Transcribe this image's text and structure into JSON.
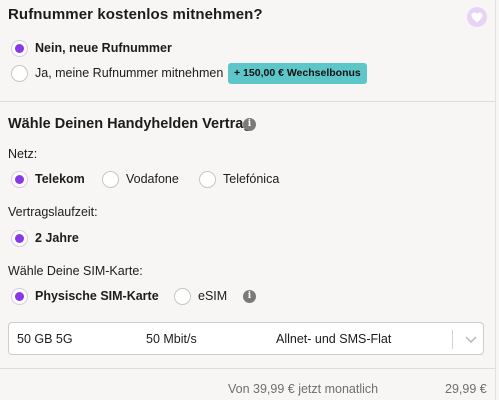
{
  "number_section": {
    "title": "Rufnummer kostenlos mitnehmen?",
    "options": [
      {
        "label": "Nein, neue Rufnummer",
        "checked": true
      },
      {
        "label": "Ja, meine Rufnummer mitnehmen",
        "checked": false
      }
    ],
    "bonus_badge": "+ 150,00 € Wechselbonus"
  },
  "contract_section": {
    "title": "Wähle Deinen Handyhelden Vertrag",
    "network": {
      "label": "Netz:",
      "options": [
        {
          "label": "Telekom",
          "checked": true
        },
        {
          "label": "Vodafone",
          "checked": false
        },
        {
          "label": "Telefónica",
          "checked": false
        }
      ]
    },
    "term": {
      "label": "Vertragslaufzeit:",
      "options": [
        {
          "label": "2 Jahre",
          "checked": true
        }
      ]
    },
    "sim": {
      "label": "Wähle Deine SIM-Karte:",
      "options": [
        {
          "label": "Physische SIM-Karte",
          "checked": true
        },
        {
          "label": "eSIM",
          "checked": false
        }
      ]
    },
    "tariff_select": {
      "data": "50 GB 5G",
      "speed": "50 Mbit/s",
      "flat": "Allnet- und SMS-Flat"
    }
  },
  "footer": {
    "old_price_text": "Von 39,99 € jetzt monatlich",
    "new_price": "29,99 €"
  },
  "colors": {
    "accent": "#8a37e8",
    "badge": "#5dc6c8",
    "heart_bg": "#e8d3f7"
  }
}
